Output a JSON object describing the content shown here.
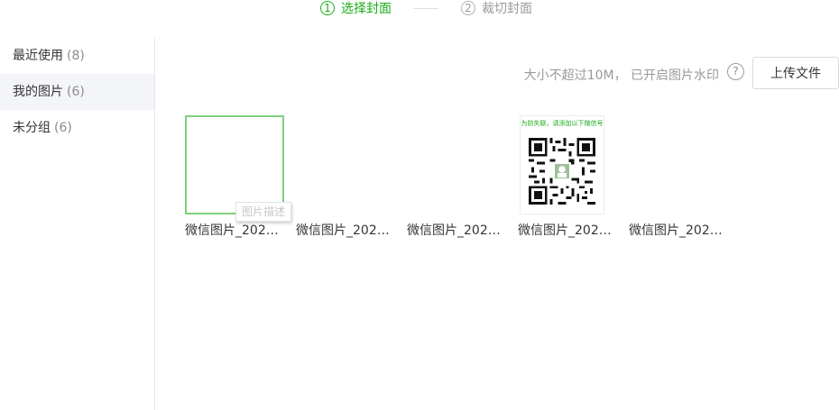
{
  "steps": [
    {
      "number": "1",
      "label": "选择封面",
      "state": "active"
    },
    {
      "number": "2",
      "label": "裁切封面",
      "state": "inactive"
    }
  ],
  "sidebar": {
    "items": [
      {
        "label": "最近使用",
        "count": "(8)",
        "selected": false
      },
      {
        "label": "我的图片",
        "count": "(6)",
        "selected": true
      },
      {
        "label": "未分组",
        "count": "(6)",
        "selected": false
      }
    ]
  },
  "toolbar": {
    "hint": "大小不超过10M， 已开启图片水印",
    "help_glyph": "?",
    "upload_label": "上传文件"
  },
  "images": [
    {
      "name": "微信图片_2020...",
      "selected": true,
      "tooltip": "图片描述"
    },
    {
      "name": "微信图片_2020...",
      "selected": false
    },
    {
      "name": "微信图片_2020...",
      "selected": false
    },
    {
      "name": "微信图片_2020...",
      "selected": false,
      "qr_caption": "为防失联，请添加以下微信号"
    },
    {
      "name": "微信图片_2020...",
      "selected": false
    }
  ],
  "colors": {
    "accent": "#1aad19",
    "selected_border": "#7ed07e"
  }
}
